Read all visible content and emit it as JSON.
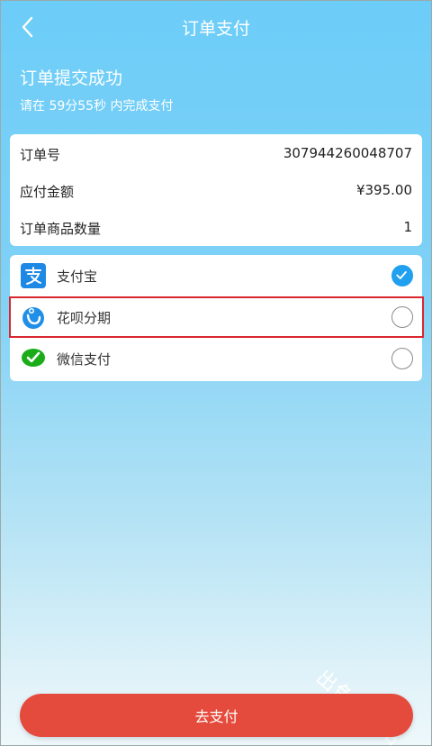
{
  "header": {
    "title": "订单支付"
  },
  "status": {
    "success_text": "订单提交成功",
    "countdown_text": "请在 59分55秒 内完成支付"
  },
  "order": {
    "rows": [
      {
        "label": "订单号",
        "value": "307944260048707"
      },
      {
        "label": "应付金额",
        "value": "¥395.00"
      },
      {
        "label": "订单商品数量",
        "value": "1"
      }
    ]
  },
  "payment": {
    "methods": [
      {
        "label": "支付宝",
        "icon": "alipay-icon",
        "selected": true
      },
      {
        "label": "花呗分期",
        "icon": "huabei-icon",
        "selected": false
      },
      {
        "label": "微信支付",
        "icon": "wechat-pay-icon",
        "selected": false
      }
    ]
  },
  "watermark": {
    "text": "出色软件站"
  },
  "footer": {
    "submit_label": "去支付"
  },
  "colors": {
    "accent": "#20a0ee",
    "submit": "#e54b3d",
    "highlight": "#d9272e",
    "alipay": "#1e88e5",
    "wechat": "#1aad19"
  }
}
